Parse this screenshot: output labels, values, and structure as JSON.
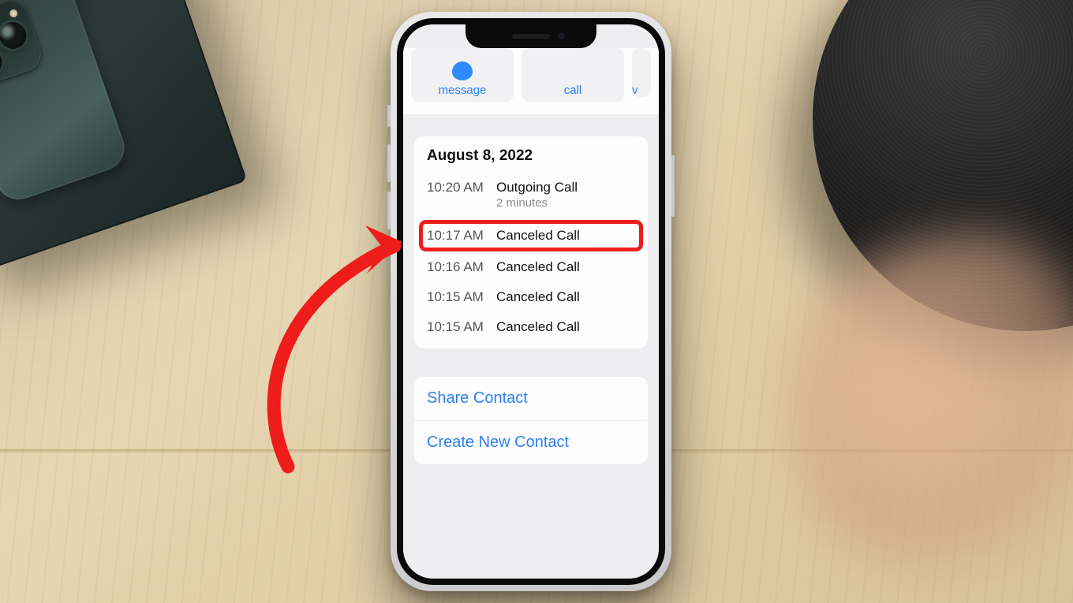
{
  "chips": {
    "message": "message",
    "call": "call",
    "video_partial": "v"
  },
  "history": {
    "date": "August 8, 2022",
    "entries": [
      {
        "time": "10:20 AM",
        "label": "Outgoing Call",
        "sub": "2 minutes"
      },
      {
        "time": "10:17 AM",
        "label": "Canceled Call",
        "highlight": true
      },
      {
        "time": "10:16 AM",
        "label": "Canceled Call"
      },
      {
        "time": "10:15 AM",
        "label": "Canceled Call"
      },
      {
        "time": "10:15 AM",
        "label": "Canceled Call"
      }
    ]
  },
  "actions": {
    "share": "Share Contact",
    "create": "Create New Contact"
  }
}
